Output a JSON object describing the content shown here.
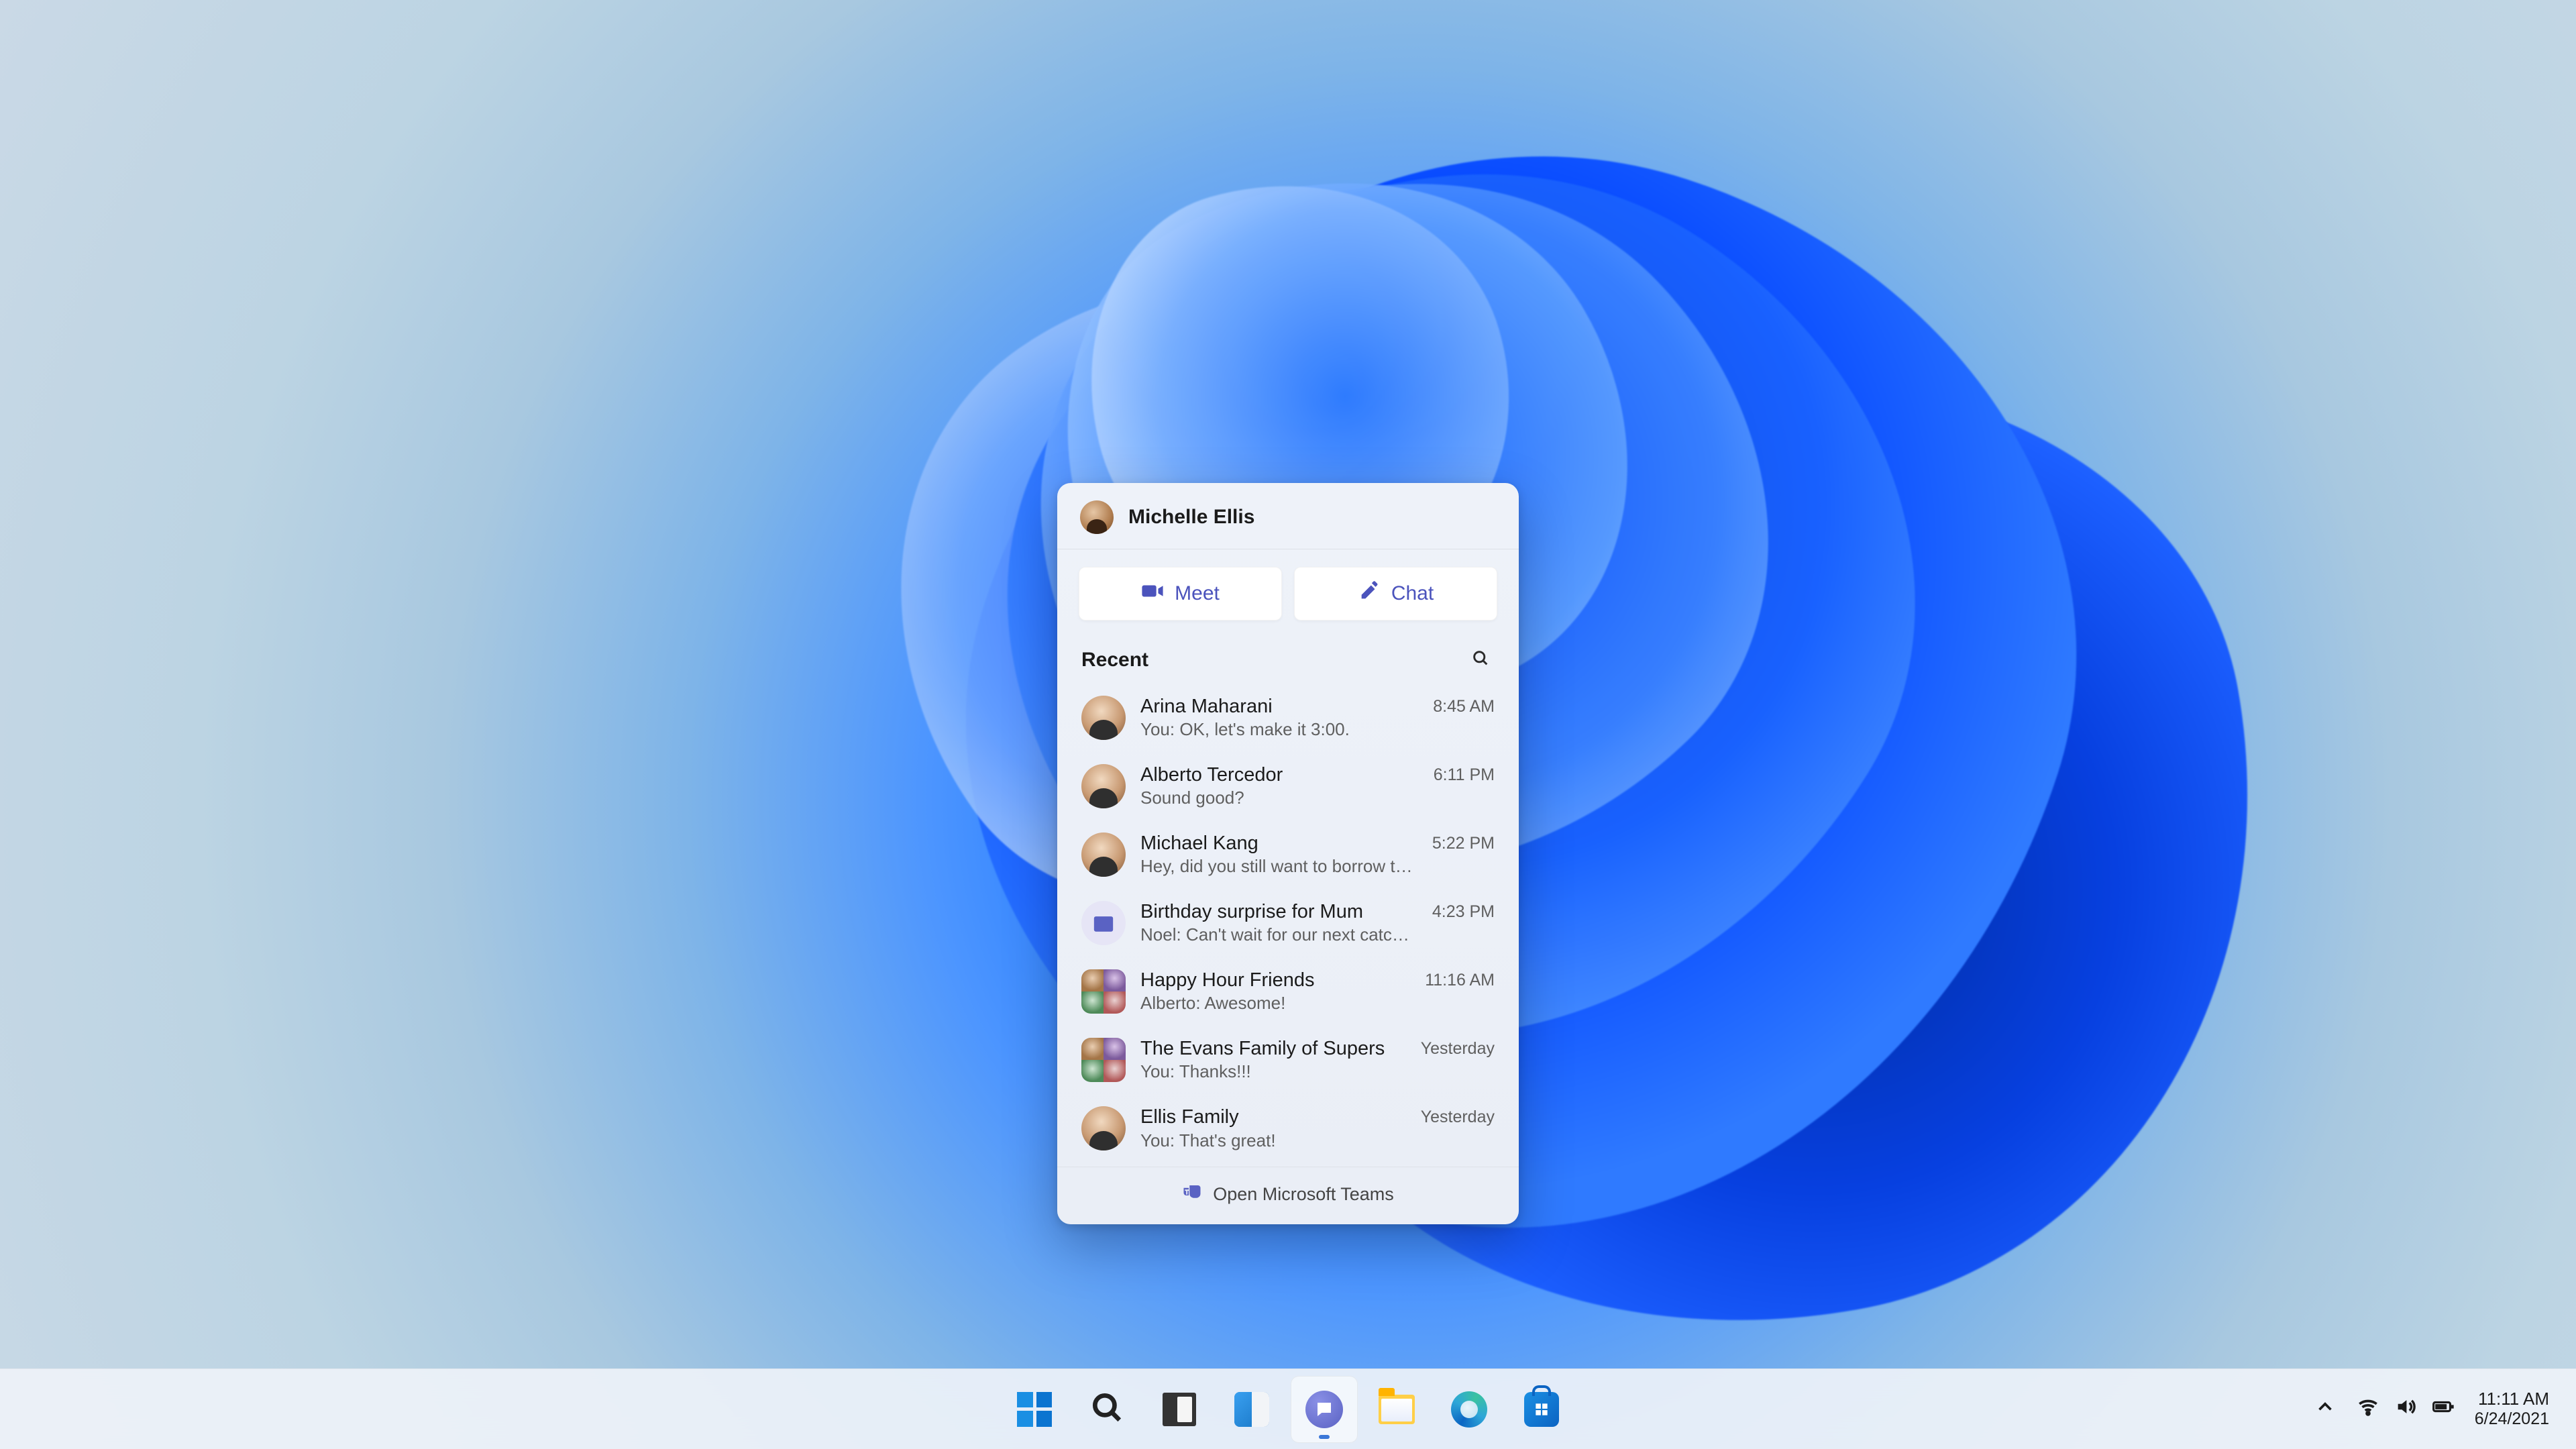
{
  "flyout": {
    "user_name": "Michelle Ellis",
    "meet_label": "Meet",
    "chat_label": "Chat",
    "recent_label": "Recent",
    "footer_label": "Open Microsoft Teams",
    "conversations": [
      {
        "name": "Arina Maharani",
        "preview": "You: OK, let's make it 3:00.",
        "time": "8:45 AM",
        "thumb": "person"
      },
      {
        "name": "Alberto Tercedor",
        "preview": "Sound good?",
        "time": "6:11 PM",
        "thumb": "person"
      },
      {
        "name": "Michael Kang",
        "preview": "Hey, did you still want to borrow the notes?",
        "time": "5:22 PM",
        "thumb": "person"
      },
      {
        "name": "Birthday surprise for Mum",
        "preview": "Noel: Can't wait for our next catch up!",
        "time": "4:23 PM",
        "thumb": "calendar"
      },
      {
        "name": "Happy Hour Friends",
        "preview": "Alberto: Awesome!",
        "time": "11:16 AM",
        "thumb": "group"
      },
      {
        "name": "The Evans Family of Supers",
        "preview": "You: Thanks!!!",
        "time": "Yesterday",
        "thumb": "group"
      },
      {
        "name": "Ellis Family",
        "preview": "You: That's great!",
        "time": "Yesterday",
        "thumb": "person"
      }
    ]
  },
  "taskbar": {
    "items": [
      {
        "id": "start",
        "icon": "windows-icon"
      },
      {
        "id": "search",
        "icon": "search-icon"
      },
      {
        "id": "taskview",
        "icon": "taskview-icon"
      },
      {
        "id": "widgets",
        "icon": "widgets-icon"
      },
      {
        "id": "chat",
        "icon": "chat-icon",
        "active": true
      },
      {
        "id": "explorer",
        "icon": "file-explorer-icon"
      },
      {
        "id": "edge",
        "icon": "edge-icon"
      },
      {
        "id": "store",
        "icon": "microsoft-store-icon"
      }
    ]
  },
  "tray": {
    "time": "11:11 AM",
    "date": "6/24/2021"
  }
}
